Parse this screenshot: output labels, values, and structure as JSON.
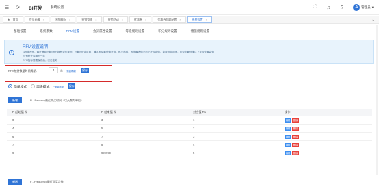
{
  "header": {
    "brand": "BI开发",
    "section": "系统设置",
    "user": "管理员"
  },
  "page_tabs": [
    {
      "label": "首页",
      "active": false
    },
    {
      "label": "会员画像",
      "active": false
    },
    {
      "label": "营销概况",
      "active": false
    },
    {
      "label": "营销管理",
      "active": false
    },
    {
      "label": "营销活动",
      "active": false
    },
    {
      "label": "优惠券",
      "active": false
    },
    {
      "label": "优惠券领取配置",
      "active": false
    },
    {
      "label": "系统设置",
      "active": true
    }
  ],
  "settings_tabs": [
    {
      "label": "基础设置",
      "active": false
    },
    {
      "label": "系统参数",
      "active": false
    },
    {
      "label": "RFM设置",
      "active": true
    },
    {
      "label": "会员属性设置",
      "active": false
    },
    {
      "label": "等级规则设置",
      "active": false
    },
    {
      "label": "积分规则设置",
      "active": false
    },
    {
      "label": "储值规则设置",
      "active": false
    }
  ],
  "info": {
    "title": "RFM设置说明",
    "lines": [
      "以R值为例，最近消费R值与R分数有对应规则，R值可设定区间，值区间从最低值开始，依次递增，系统最大值不可小于设定值，如要设定区间，可设定最低值以下至设定最高值",
      "RFM统计周期为一年",
      "RFM指标需要保存后，次日生效"
    ]
  },
  "rfm_period": {
    "label": "RFM统计数据时间周期：",
    "value": "2",
    "unit": "年",
    "note": "*需要刷新",
    "save": "保存"
  },
  "mode": {
    "options": [
      {
        "label": "简单模式",
        "checked": true
      },
      {
        "label": "高级模式",
        "checked": false
      }
    ],
    "note": "*需要刷新",
    "save": "保存"
  },
  "r_section": {
    "add_label": "新增",
    "description": "R - Recency最近购买时间（以天数为单位）"
  },
  "table": {
    "headers": [
      "R 起始值 ⇅",
      "R 结束值 ⇅",
      "对应值 R1",
      "操作"
    ],
    "rows": [
      {
        "start": "0",
        "end": "3",
        "score": "1"
      },
      {
        "start": "4",
        "end": "5",
        "score": "2"
      },
      {
        "start": "6",
        "end": "7",
        "score": "3"
      },
      {
        "start": "7",
        "end": "8",
        "score": "4"
      },
      {
        "start": "9",
        "end": "999999",
        "score": "5"
      }
    ],
    "edit_label": "编辑",
    "delete_label": "删除"
  },
  "f_section": {
    "add_label": "新增",
    "description": "F - Frequency最近购买次数"
  }
}
